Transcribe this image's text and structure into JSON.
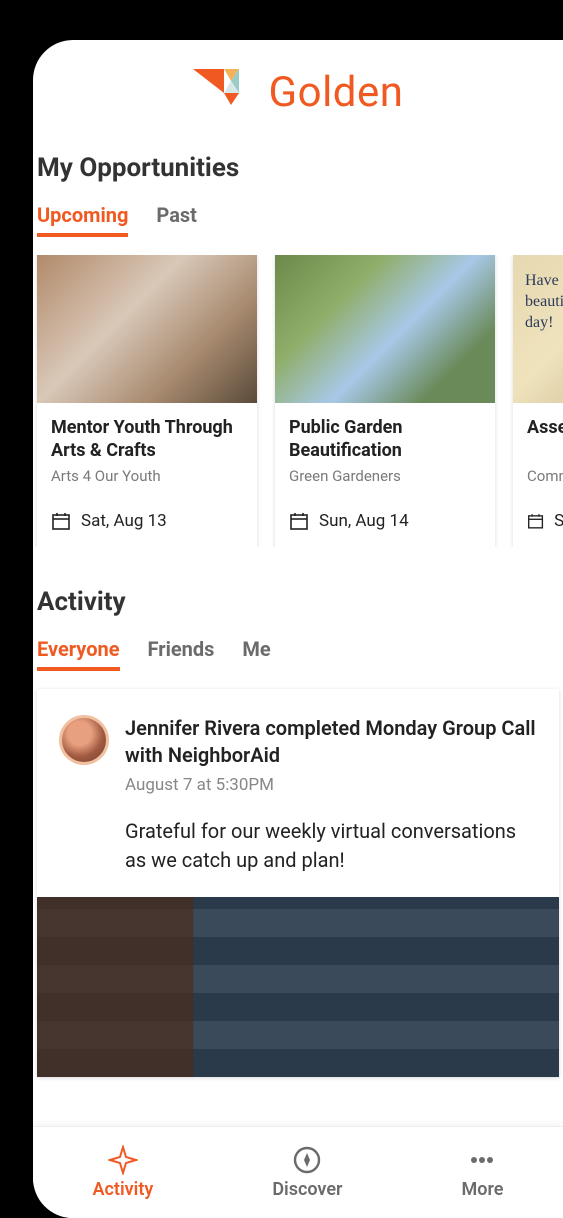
{
  "brand": {
    "name": "Golden"
  },
  "opportunities": {
    "heading": "My Opportunities",
    "tabs": [
      {
        "label": "Upcoming",
        "active": true
      },
      {
        "label": "Past",
        "active": false
      }
    ],
    "cards": [
      {
        "title": "Mentor Youth Through Arts & Crafts",
        "org": "Arts 4 Our Youth",
        "date": "Sat, Aug 13"
      },
      {
        "title": "Public Garden Beautification",
        "org": "Green Gardeners",
        "date": "Sun, Aug 14"
      },
      {
        "title": "Assemble & Deliver",
        "org": "Community",
        "date": "Sat"
      }
    ],
    "note_text": "Have a\nbeautiful\nday!"
  },
  "activity": {
    "heading": "Activity",
    "tabs": [
      {
        "label": "Everyone",
        "active": true
      },
      {
        "label": "Friends",
        "active": false
      },
      {
        "label": "Me",
        "active": false
      }
    ],
    "feed": {
      "headline": "Jennifer Rivera completed Monday Group Call with NeighborAid",
      "timestamp": "August 7 at 5:30PM",
      "body": "Grateful for our weekly virtual conversations as we catch up and plan!"
    }
  },
  "nav": {
    "items": [
      {
        "label": "Activity",
        "active": true
      },
      {
        "label": "Discover",
        "active": false
      },
      {
        "label": "More",
        "active": false
      }
    ]
  }
}
